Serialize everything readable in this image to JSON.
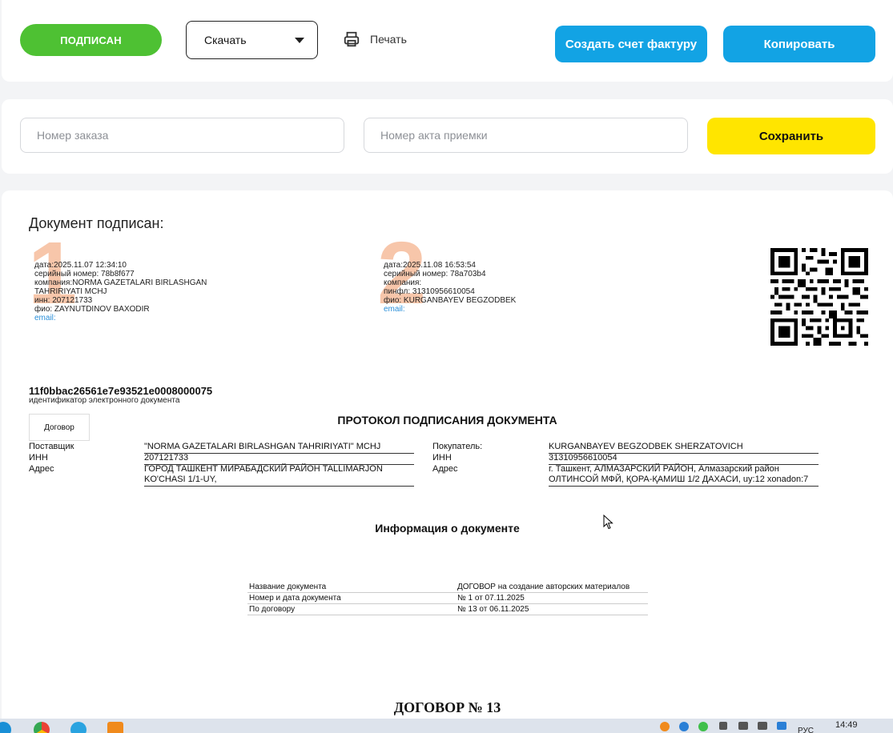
{
  "toolbar": {
    "status_label": "ПОДПИСАН",
    "download_select_value": "Скачать",
    "print_label": "Печать",
    "create_invoice_label": "Создать счет фактуру",
    "copy_label": "Копировать"
  },
  "form": {
    "order_number_placeholder": "Номер заказа",
    "acceptance_act_placeholder": "Номер акта приемки",
    "save_label": "Сохранить"
  },
  "signatures": {
    "heading": "Документ подписан:",
    "items": [
      {
        "number": "1",
        "lines": [
          "дата:2025.11.07 12:34:10",
          "серийный номер: 78b8f677",
          "компания:NORMA GAZETALARI BIRLASHGAN",
          "TAHRIRIYATI MCHJ",
          "инн: 207121733",
          "фио: ZAYNUTDINOV BAXODIR"
        ],
        "email": "email:"
      },
      {
        "number": "2",
        "lines": [
          "дата:2025.11.08 16:53:54",
          "серийный номер: 78a703b4",
          "компания:",
          "пинфл: 31310956610054",
          "фио: KURGANBAYEV BEGZODBEK"
        ],
        "email": "email:"
      }
    ]
  },
  "document": {
    "id": "11f0bbac26561e7e93521e0008000075",
    "id_label": "идентификатор электронного документа",
    "type": "Договор",
    "protocol_title": "ПРОТОКОЛ ПОДПИСАНИЯ ДОКУМЕНТА",
    "supplier": {
      "label": "Поставщик",
      "name": "\"NORMA GAZETALARI BIRLASHGAN TAHRIRIYATI\" MCHJ",
      "inn_label": "ИНН",
      "inn": "207121733",
      "address_label": "Адрес",
      "address": "ГОРОД ТАШКЕНТ МИРАБАДСКИЙ РАЙОН TALLIMARJON KO'CHASI 1/1-UY,"
    },
    "buyer": {
      "label": "Покупатель:",
      "name": "KURGANBAYEV BEGZODBEK SHERZATOVICH",
      "inn_label": "ИНН",
      "inn": "31310956610054",
      "address_label": "Адрес",
      "address": "г. Ташкент, АЛМАЗАРСКИЙ РАЙОН, Алмазарский район ОЛТИНСОЙ МФЙ, ҚОРА-ҚАМИШ 1/2 ДАХАСИ, uy:12 xonadon:7"
    },
    "info_title": "Информация о документе",
    "info_rows": [
      {
        "label": "Название документа",
        "value": "ДОГОВОР на создание авторских материалов"
      },
      {
        "label": "Номер и дата документа",
        "value": "№ 1 от 07.11.2025"
      },
      {
        "label": "По договору",
        "value": "№ 13 от 06.11.2025"
      }
    ],
    "contract_title": "ДОГОВОР № 13"
  },
  "taskbar": {
    "time": "14:49",
    "lang": "РУС"
  },
  "colors": {
    "status_green": "#4ec133",
    "action_blue": "#12a3e4",
    "save_yellow": "#ffe500",
    "sig_number": "#f6b896",
    "email_link": "#2a8fd9"
  }
}
